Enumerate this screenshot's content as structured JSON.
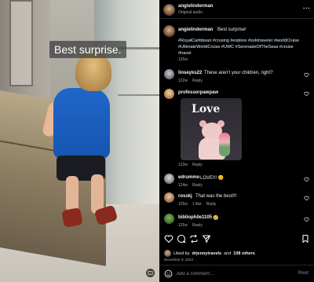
{
  "video": {
    "caption": "Best surprise."
  },
  "header": {
    "username": "angielinderman",
    "subtitle": "Original audio"
  },
  "post": {
    "username": "angielinderman",
    "text": "Best surprise!",
    "hashtags": "#RoyalCaribbean #crusing #explore #solotraveler #worldCruise #UltimateWorldCruise #UWC #SerenadeOfTheSeas #cruise #travel",
    "age": "125w"
  },
  "comments": [
    {
      "username": "linseyks22",
      "text": "These aren't your children, right?",
      "age": "122w",
      "likes": "",
      "reply": "Reply"
    },
    {
      "username": "professorpawpaw",
      "text": "",
      "age": "123w",
      "likes": "",
      "reply": "Reply",
      "gif_text": "Love"
    },
    {
      "username": "edrummo",
      "text": "LOVE!!! 😊",
      "age": "124w",
      "likes": "",
      "reply": "Reply"
    },
    {
      "username": "rosskj",
      "text": "That was the best!!!",
      "age": "125w",
      "likes": "1 like",
      "reply": "Reply"
    },
    {
      "username": "bibliophile1105",
      "text": "😢",
      "age": "125w",
      "likes": "",
      "reply": "Reply"
    }
  ],
  "liked_by": {
    "prefix": "Liked by",
    "user": "drjennytravels",
    "joiner": "and",
    "others": "108 others"
  },
  "date": "December 9, 2023",
  "add_comment": {
    "placeholder": "Add a comment…",
    "post_label": "Post"
  },
  "icons": {
    "more": "more-horizontal-icon",
    "like": "heart-icon",
    "comment": "comment-icon",
    "share": "share-icon",
    "save": "bookmark-icon",
    "emoji": "emoji-icon",
    "captions": "closed-captions-icon"
  },
  "colors": {
    "background": "#000000",
    "text": "#f5f5f5",
    "muted": "#a8a8a8",
    "hashtag": "#e0f1ff",
    "post_disabled": "#5b6f8d",
    "shirt": "#1f66c9"
  }
}
